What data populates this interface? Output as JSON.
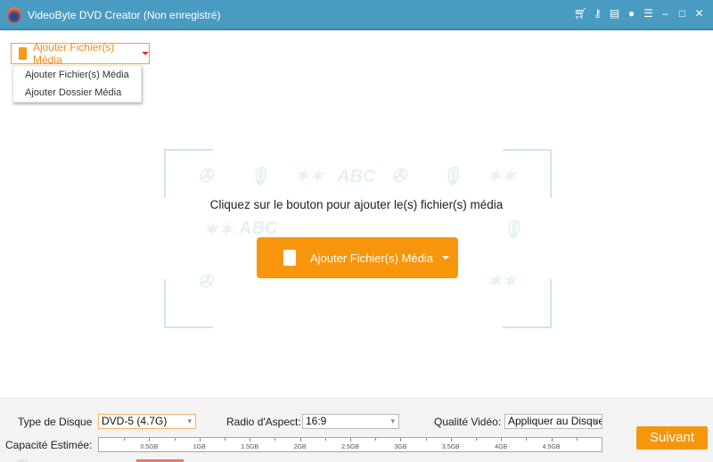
{
  "window": {
    "title": "VideoByte DVD Creator (Non enregistré)",
    "icons": [
      "cart-icon",
      "key-icon",
      "save-icon",
      "chat-icon",
      "feedback-icon",
      "minimize-icon",
      "maximize-icon",
      "close-icon"
    ]
  },
  "add_menu": {
    "button_label": "Ajouter Fichier(s) Média",
    "items": [
      "Ajouter Fichier(s) Média",
      "Ajouter Dossier Média"
    ]
  },
  "main": {
    "hint": "Cliquez sur le bouton pour ajouter le(s) fichier(s) média",
    "add_button_label": "Ajouter Fichier(s) Média",
    "pattern_text": "ABC"
  },
  "bottom": {
    "disc_type_label": "Type de Disque",
    "disc_type_value": "DVD-5 (4.7G)",
    "aspect_label": "Radio d'Aspect:",
    "aspect_value": "16:9",
    "quality_label": "Qualité Vidéo:",
    "quality_value": "Appliquer au Disque",
    "capacity_label": "Capacité Estimée:",
    "capacity_ticks": [
      "0.5GB",
      "1GB",
      "1.5GB",
      "2GB",
      "2.5GB",
      "3GB",
      "3.5GB",
      "4GB",
      "4.5GB"
    ],
    "next_label": "Suivant"
  },
  "colors": {
    "titlebar": "#4a9bc1",
    "accent": "#f7960c"
  }
}
